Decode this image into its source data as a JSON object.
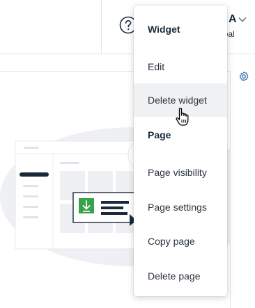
{
  "header": {
    "help_icon": "help-circle-icon",
    "user_initial": "A",
    "user_scope": "obal",
    "chevron_icon": "chevron-down-icon"
  },
  "page": {
    "settings_icon": "gear-icon"
  },
  "menu": {
    "sections": [
      {
        "heading": "Widget",
        "items": [
          {
            "label": "Edit"
          },
          {
            "label": "Delete widget",
            "state": "hover"
          }
        ]
      },
      {
        "heading": "Page",
        "items": [
          {
            "label": "Page visibility"
          },
          {
            "label": "Page settings"
          },
          {
            "label": "Copy page"
          },
          {
            "label": "Delete page"
          }
        ]
      }
    ]
  },
  "colors": {
    "brand_navy": "#1b2a3a",
    "download_green": "#3aa34a",
    "hover_bg": "#f0f1f3"
  }
}
